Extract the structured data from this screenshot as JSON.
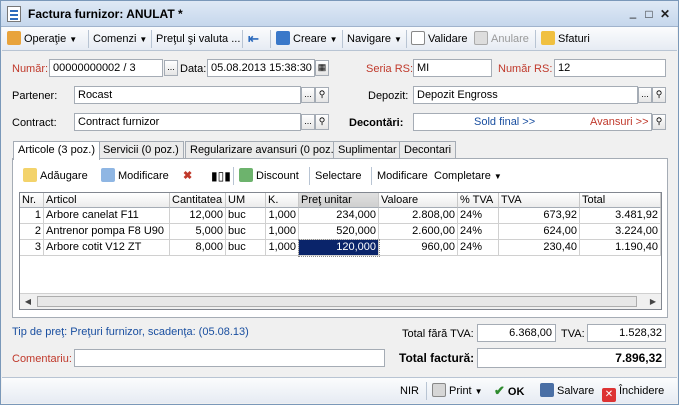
{
  "window": {
    "title": "Factura furnizor: ANULAT *"
  },
  "toolbar": {
    "operatie": "Operaţie",
    "comenzi": "Comenzi",
    "pretul": "Preţul şi valuta ...",
    "creare": "Creare",
    "navigare": "Navigare",
    "validare": "Validare",
    "anulare": "Anulare",
    "sfaturi": "Sfaturi"
  },
  "form": {
    "numar_label": "Număr:",
    "numar_value": "00000000002 / 3",
    "data_label": "Data:",
    "data_value": "05.08.2013 15:38:30",
    "seria_label": "Seria RS:",
    "seria_value": "MI",
    "numar_rs_label": "Număr RS:",
    "numar_rs_value": "12",
    "partener_label": "Partener:",
    "partener_value": "Rocast",
    "depozit_label": "Depozit:",
    "depozit_value": "Depozit Engross",
    "contract_label": "Contract:",
    "contract_value": "Contract furnizor",
    "decontari_label": "Decontări:",
    "sold_final": "Sold final >>",
    "avansuri": "Avansuri >>"
  },
  "tabs": [
    "Articole (3 poz.)",
    "Servicii (0 poz.)",
    "Regularizare avansuri (0 poz.)",
    "Suplimentar",
    "Decontari"
  ],
  "grid_toolbar": {
    "adaugare": "Adăugare",
    "modificare": "Modificare",
    "discount": "Discount",
    "selectare": "Selectare",
    "modificare2": "Modificare",
    "completare": "Completare"
  },
  "grid": {
    "headers": [
      "Nr.",
      "Articol",
      "Cantitatea",
      "UM",
      "K.",
      "Preţ unitar",
      "Valoare",
      "% TVA",
      "TVA",
      "Total"
    ],
    "rows": [
      [
        "1",
        "Arbore canelat F11",
        "12,000",
        "buc",
        "1,000",
        "234,000",
        "2.808,00",
        "24%",
        "673,92",
        "3.481,92"
      ],
      [
        "2",
        "Antrenor pompa F8 U90",
        "5,000",
        "buc",
        "1,000",
        "520,000",
        "2.600,00",
        "24%",
        "624,00",
        "3.224,00"
      ],
      [
        "3",
        "Arbore cotit V12 ZT",
        "8,000",
        "buc",
        "1,000",
        "120,000",
        "960,00",
        "24%",
        "230,40",
        "1.190,40"
      ]
    ]
  },
  "footer": {
    "tip_pret": "Tip de preţ: Preţuri furnizor, scadenţa:  (05.08.13)",
    "total_fara_label": "Total fără TVA:",
    "total_fara_value": "6.368,00",
    "tva_label": "TVA:",
    "tva_value": "1.528,32",
    "comentariu_label": "Comentariu:",
    "comentariu_value": "",
    "total_label": "Total factură:",
    "total_value": "7.896,32"
  },
  "bottom": {
    "nir": "NIR",
    "print": "Print",
    "ok": "OK",
    "salvare": "Salvare",
    "inchidere": "Închidere"
  }
}
